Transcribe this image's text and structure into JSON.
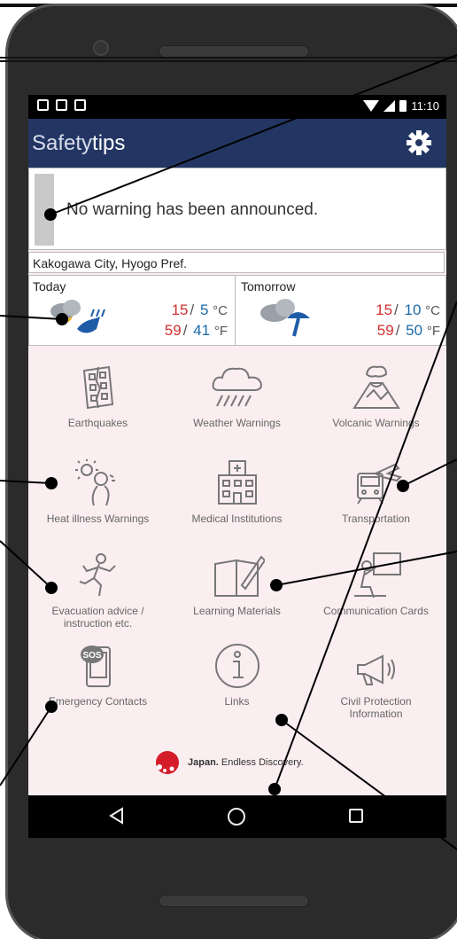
{
  "status_bar": {
    "time": "11:10"
  },
  "app": {
    "logo_part1": "Safety",
    "logo_part2": "tips"
  },
  "warning": {
    "message": "No warning has been announced."
  },
  "location": {
    "city": "Kakogawa City, Hyogo Pref."
  },
  "weather": {
    "today": {
      "label": "Today",
      "high_c": "15",
      "low_c": "5",
      "high_f": "59",
      "low_f": "41",
      "icon": "cloud-heat-icon"
    },
    "tomorrow": {
      "label": "Tomorrow",
      "high_c": "15",
      "low_c": "10",
      "high_f": "59",
      "low_f": "50",
      "icon": "cloud-umbrella-icon"
    },
    "unit_c": "°C",
    "unit_f": "°F",
    "sep": "/"
  },
  "menu": {
    "earthquakes": "Earthquakes",
    "weather_warnings": "Weather Warnings",
    "volcanic_warnings": "Volcanic Warnings",
    "heat_illness": "Heat illness Warnings",
    "medical": "Medical Institutions",
    "transportation": "Transportation",
    "evacuation_line1": "Evacuation advice /",
    "evacuation_line2": "instruction etc.",
    "learning": "Learning Materials",
    "communication": "Communication Cards",
    "emergency": "Emergency Contacts",
    "links": "Links",
    "civil_line1": "Civil Protection",
    "civil_line2": "Information",
    "sos_text": "SOS"
  },
  "brand": {
    "bold": "Japan.",
    "rest": " Endless Discovery."
  },
  "colors": {
    "appbar": "#233663",
    "hi_temp": "#d0302e",
    "lo_temp": "#1d6aa7",
    "screen_bg": "#fbeef0"
  }
}
